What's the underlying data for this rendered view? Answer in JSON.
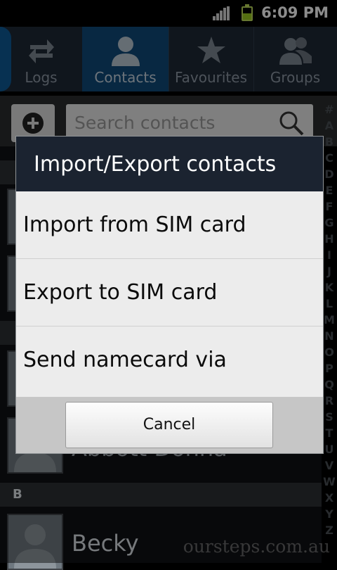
{
  "status": {
    "time": "6:09 PM"
  },
  "tabs": [
    {
      "label": "Logs",
      "icon": "swap-arrows-icon",
      "active": false
    },
    {
      "label": "Contacts",
      "icon": "person-icon",
      "active": true
    },
    {
      "label": "Favourites",
      "icon": "star-icon",
      "active": false
    },
    {
      "label": "Groups",
      "icon": "group-icon",
      "active": false
    }
  ],
  "search": {
    "placeholder": "Search contacts"
  },
  "index": [
    "#",
    "A",
    "B",
    "C",
    "D",
    "E",
    "F",
    "G",
    "H",
    "I",
    "J",
    "K",
    "L",
    "M",
    "N",
    "O",
    "P",
    "Q",
    "R",
    "S",
    "T",
    "U",
    "V",
    "W",
    "X",
    "Y",
    "Z"
  ],
  "list": {
    "section_b": "B",
    "contact_partial": "Abbott Donna",
    "contact_becky": "Becky"
  },
  "watermark": "oursteps.com.au",
  "dialog": {
    "title": "Import/Export contacts",
    "options": [
      "Import from SIM card",
      "Export to SIM card",
      "Send namecard via"
    ],
    "cancel_label": "Cancel"
  },
  "colors": {
    "active_tab": "#104a78",
    "dialog_title_bg": "#1b2330",
    "battery": "#9ccc1f"
  }
}
